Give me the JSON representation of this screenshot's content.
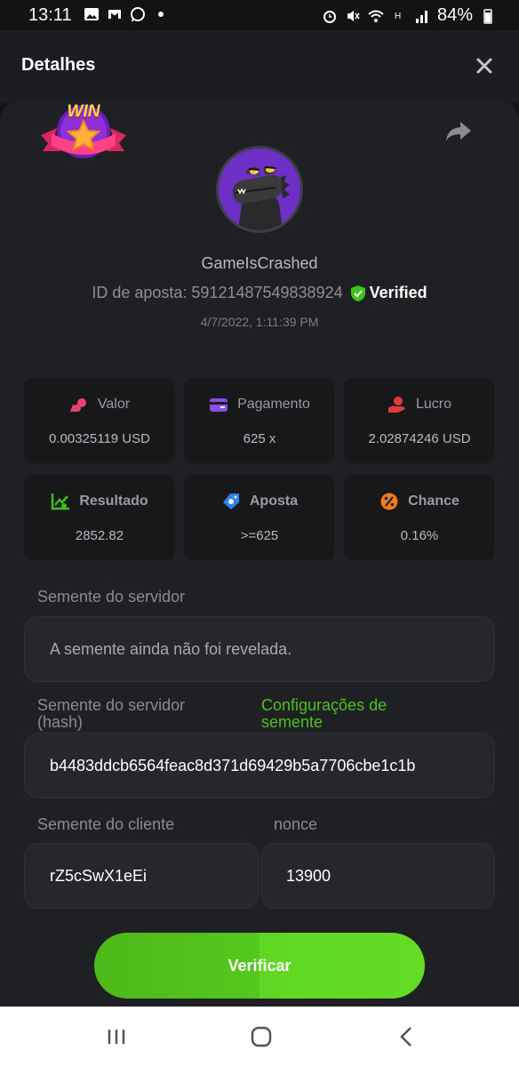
{
  "status_bar": {
    "time": "13:11",
    "battery": "84%",
    "left_icons": [
      "image-icon",
      "gmail-icon",
      "whatsapp-icon",
      "dot-icon"
    ],
    "right_icons": [
      "alarm-icon",
      "mute-icon",
      "wifi-icon",
      "h-plus-icon",
      "signal-icon",
      "battery-icon"
    ]
  },
  "header": {
    "title": "Detalhes",
    "close_icon": "close-icon"
  },
  "bet": {
    "badge": "WIN",
    "username": "GameIsCrashed",
    "id_label": "ID de aposta: 59121487549838924",
    "verified": "Verified",
    "date": "4/7/2022, 1:11:39 PM"
  },
  "stats": [
    {
      "label": "Valor",
      "value": "0.00325119 USD",
      "icon": "coins-icon",
      "color": "#e8436f"
    },
    {
      "label": "Pagamento",
      "value": "625 x",
      "icon": "wallet-icon",
      "color": "#8a4be8"
    },
    {
      "label": "Lucro",
      "value": "2.02874246 USD",
      "icon": "hand-coin-icon",
      "color": "#e23b3b"
    },
    {
      "label": "Resultado",
      "value": "2852.82",
      "icon": "chart-icon",
      "color": "#3fbf1f"
    },
    {
      "label": "Aposta",
      "value": ">=625",
      "icon": "ticket-icon",
      "color": "#2f7ff0"
    },
    {
      "label": "Chance",
      "value": "0.16%",
      "icon": "percent-icon",
      "color": "#f07a1a"
    }
  ],
  "fields": {
    "server_seed_label": "Semente do servidor",
    "server_seed_value": "A semente ainda não foi revelada.",
    "server_hash_label_1": "Semente do servidor",
    "server_hash_label_2": "(hash)",
    "seed_settings_1": "Configurações de",
    "seed_settings_2": "semente",
    "server_hash_value": "b4483ddcb6564feac8d371d69429b5a7706cbe1c1b",
    "client_seed_label": "Semente do cliente",
    "client_seed_value": "rZ5cSwX1eEi",
    "nonce_label": "nonce",
    "nonce_value": "13900"
  },
  "verify_button": "Verificar",
  "nav": [
    "recents-icon",
    "home-icon",
    "back-icon"
  ]
}
